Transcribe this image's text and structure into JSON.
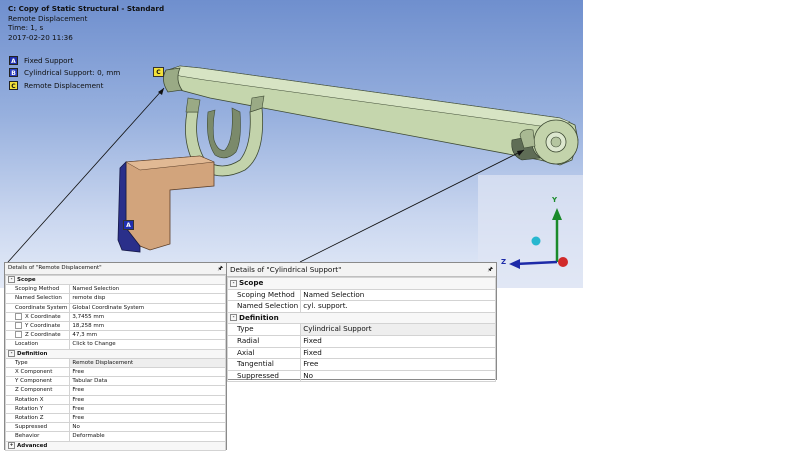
{
  "viewport": {
    "title_line1": "C: Copy of Static Structural - Standard",
    "title_line2": "Remote Displacement",
    "title_line3": "Time: 1, s",
    "title_line4": "2017-02-20 11:36",
    "legend": [
      {
        "letter": "A",
        "label": "Fixed Support",
        "color": "#1f2fb0",
        "text_color": "#ffffff"
      },
      {
        "letter": "B",
        "label": "Cylindrical Support: 0, mm",
        "color": "#2a3dbf",
        "text_color": "#ffffff"
      },
      {
        "letter": "C",
        "label": "Remote Displacement",
        "color": "#f2e03a",
        "text_color": "#111111"
      }
    ],
    "tags": {
      "a": "A",
      "c": "C"
    },
    "triad": {
      "y": "Y",
      "z": "Z"
    }
  },
  "panel_remote": {
    "title": "Details of \"Remote Displacement\"",
    "pin_icon": "pin-icon",
    "sections": [
      {
        "title": "Scope",
        "expander": "-",
        "rows": [
          {
            "key": "Scoping Method",
            "value": "Named Selection"
          },
          {
            "key": "Named Selection",
            "value": "remote disp"
          },
          {
            "key": "Coordinate System",
            "value": "Global Coordinate System"
          },
          {
            "key": "X Coordinate",
            "value": "3,7455 mm"
          },
          {
            "key": "Y Coordinate",
            "value": "18,258 mm"
          },
          {
            "key": "Z Coordinate",
            "value": "47,3 mm"
          },
          {
            "key": "Location",
            "value": "Click to Change"
          }
        ]
      },
      {
        "title": "Definition",
        "expander": "-",
        "rows": [
          {
            "key": "Type",
            "value": "Remote Displacement"
          },
          {
            "key": "X Component",
            "value": "Free"
          },
          {
            "key": "Y Component",
            "value": "Tabular Data"
          },
          {
            "key": "Z Component",
            "value": "Free"
          },
          {
            "key": "Rotation X",
            "value": "Free"
          },
          {
            "key": "Rotation Y",
            "value": "Free"
          },
          {
            "key": "Rotation Z",
            "value": "Free"
          },
          {
            "key": "Suppressed",
            "value": "No"
          },
          {
            "key": "Behavior",
            "value": "Deformable"
          }
        ]
      },
      {
        "title": "Advanced",
        "expander": "+"
      }
    ]
  },
  "panel_cyl": {
    "title": "Details of \"Cylindrical Support\"",
    "sections": [
      {
        "title": "Scope",
        "expander": "-",
        "rows": [
          {
            "key": "Scoping Method",
            "value": "Named Selection"
          },
          {
            "key": "Named Selection",
            "value": "cyl. support."
          }
        ]
      },
      {
        "title": "Definition",
        "expander": "-",
        "rows": [
          {
            "key": "Type",
            "value": "Cylindrical Support"
          },
          {
            "key": "Radial",
            "value": "Fixed"
          },
          {
            "key": "Axial",
            "value": "Fixed"
          },
          {
            "key": "Tangential",
            "value": "Free"
          },
          {
            "key": "Suppressed",
            "value": "No"
          }
        ]
      }
    ]
  }
}
